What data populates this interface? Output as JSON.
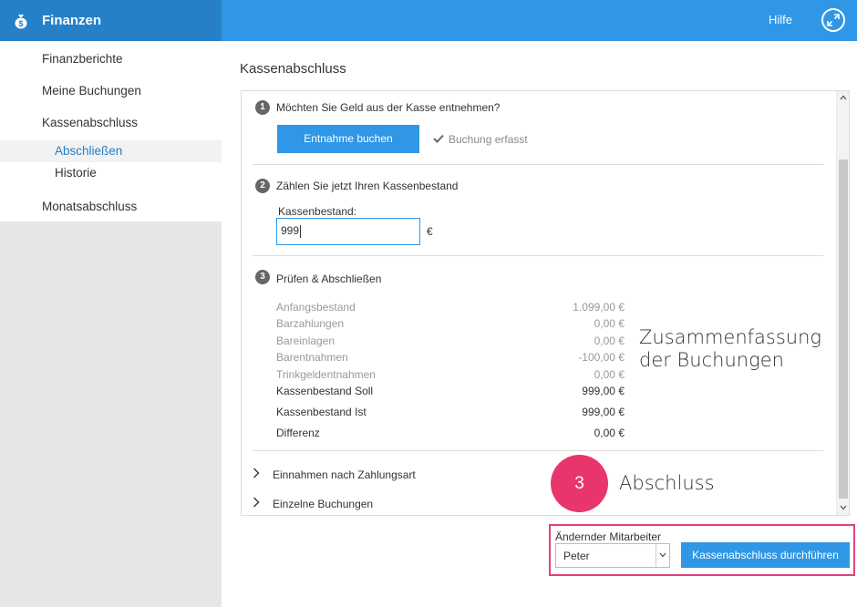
{
  "header": {
    "app_title": "Finanzen",
    "help_label": "Hilfe",
    "app_icon": "money-bag-icon",
    "fullscreen_icon": "expand-icon",
    "bar_color": "#2f97e5",
    "brand_color": "#2580c8"
  },
  "sidebar": {
    "items": [
      {
        "label": "Finanzberichte"
      },
      {
        "label": "Meine Buchungen"
      },
      {
        "label": "Kassenabschluss"
      },
      {
        "label": "Abschließen"
      },
      {
        "label": "Historie"
      },
      {
        "label": "Monatsabschluss"
      }
    ],
    "active_item": "Abschließen"
  },
  "main": {
    "title": "Kassenabschluss",
    "step1": {
      "number": "1",
      "title": "Möchten Sie Geld aus der Kasse entnehmen?",
      "button_label": "Entnahme buchen",
      "status": "Buchung erfasst"
    },
    "step2": {
      "number": "2",
      "title": "Zählen Sie jetzt Ihren Kassenbestand",
      "field_label": "Kassenbestand:",
      "field_value": "999",
      "unit": "€"
    },
    "step3": {
      "number": "3",
      "title": "Prüfen & Abschließen",
      "rows": [
        {
          "label": "Anfangsbestand",
          "value": "1.099,00 €"
        },
        {
          "label": "Barzahlungen",
          "value": "0,00 €"
        },
        {
          "label": "Bareinlagen",
          "value": "0,00 €"
        },
        {
          "label": "Barentnahmen",
          "value": "-100,00 €"
        },
        {
          "label": "Trinkgeldentnahmen",
          "value": "0,00 €"
        },
        {
          "label": "Kassenbestand Soll",
          "value": "999,00 €"
        },
        {
          "label": "Kassenbestand Ist",
          "value": "999,00 €"
        },
        {
          "label": "Differenz",
          "value": "0,00 €"
        }
      ]
    },
    "expanders": [
      {
        "label": "Einnahmen nach Zahlungsart"
      },
      {
        "label": "Einzelne Buchungen"
      }
    ]
  },
  "annotations": {
    "summary_line1": "Zusammenfassung",
    "summary_line2": "der Buchungen",
    "badge": "3",
    "closing": "Abschluss",
    "badge_color": "#e8366d",
    "box_color": "#e0427d"
  },
  "footer": {
    "employee_label": "Ändernder Mitarbeiter",
    "employee_value": "Peter",
    "submit_label": "Kassenabschluss durchführen"
  }
}
